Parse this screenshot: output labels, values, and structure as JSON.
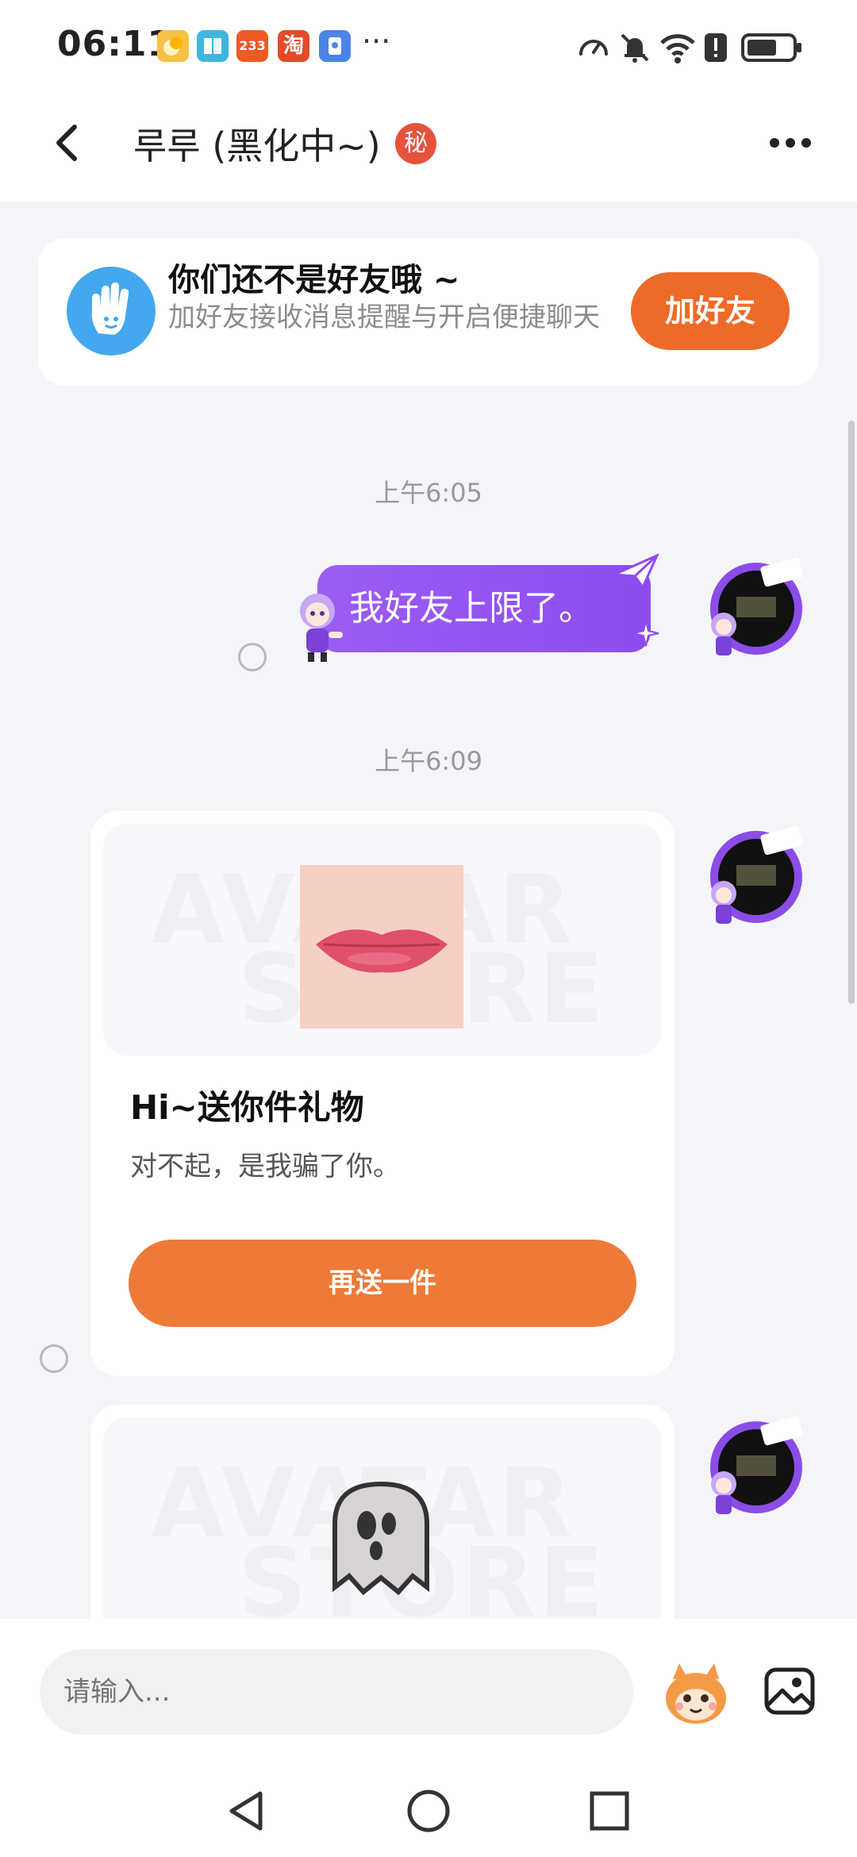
{
  "status_bar": {
    "time": "06:11",
    "app_icon_233": "233",
    "app_icon_tao": "淘",
    "more": "···",
    "colors": [
      "#f6b23c",
      "#3fb6de",
      "#ee5a24",
      "#e34b2a",
      "#4b84e6"
    ]
  },
  "header": {
    "title": "루루 (黑化中~)",
    "secret_badge": "秘"
  },
  "friend_banner": {
    "title": "你们还不是好友哦 ~",
    "subtitle": "加好友接收消息提醒与开启便捷聊天",
    "button": "加好友"
  },
  "messages": {
    "time1": "上午6:05",
    "bubble_text": "我好友上限了。",
    "time2": "上午6:09"
  },
  "gift_card_1": {
    "watermark_top": "AVATAR",
    "watermark_bottom": "STORE",
    "title": "Hi~送你件礼物",
    "desc": "对不起，是我骗了你。",
    "button": "再送一件"
  },
  "gift_card_2": {
    "watermark_top": "AVATAR",
    "watermark_bottom": "STORE"
  },
  "input": {
    "placeholder": "请输入..."
  },
  "colors": {
    "accent_orange": "#ee6a27",
    "bubble_purple": "#9356f2",
    "hand_blue": "#43a8ef"
  }
}
